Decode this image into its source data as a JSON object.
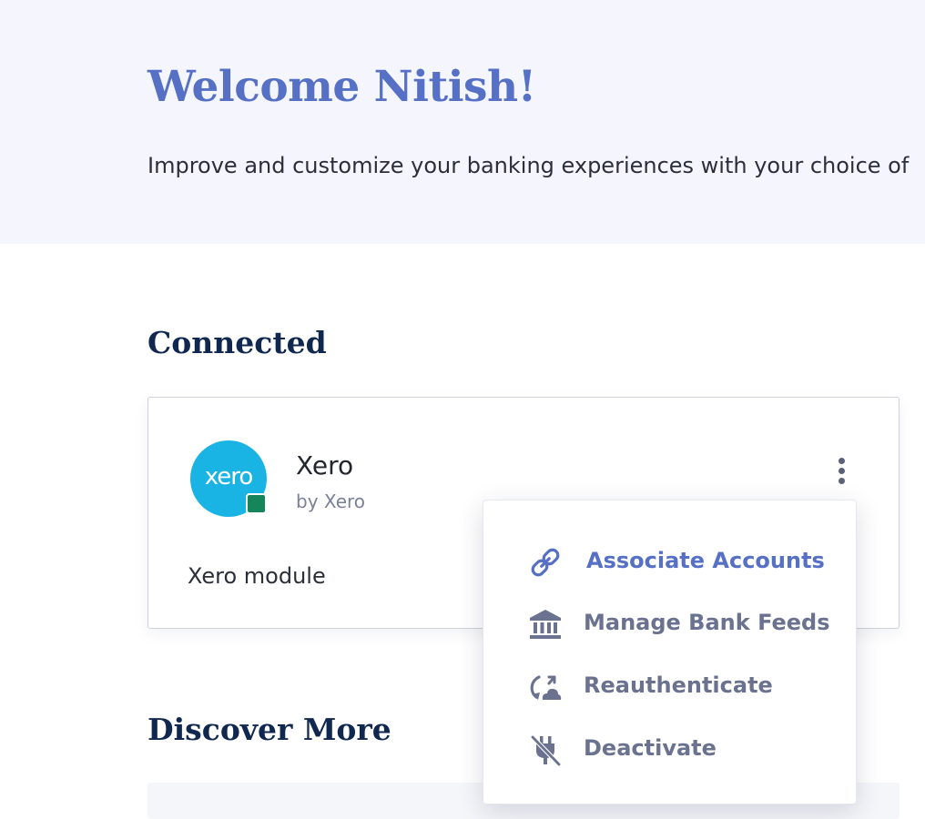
{
  "hero": {
    "title": "Welcome Nitish!",
    "subtitle": "Improve and customize your banking experiences with your choice of"
  },
  "sections": {
    "connected": "Connected",
    "discover": "Discover More"
  },
  "card": {
    "logo_text": "xero",
    "name": "Xero",
    "vendor": "by Xero",
    "description": "Xero module",
    "status_color": "#16855a",
    "logo_color": "#1ab4e4"
  },
  "menu": {
    "items": [
      {
        "label": "Associate Accounts",
        "icon": "link-icon",
        "active": true
      },
      {
        "label": "Manage Bank Feeds",
        "icon": "bank-icon",
        "active": false
      },
      {
        "label": "Reauthenticate",
        "icon": "reauth-icon",
        "active": false
      },
      {
        "label": "Deactivate",
        "icon": "power-off-icon",
        "active": false
      }
    ]
  },
  "colors": {
    "accent": "#5570c4",
    "heading": "#10284f",
    "hero_bg": "#f5f6fd",
    "menu_text": "#6a7290"
  }
}
